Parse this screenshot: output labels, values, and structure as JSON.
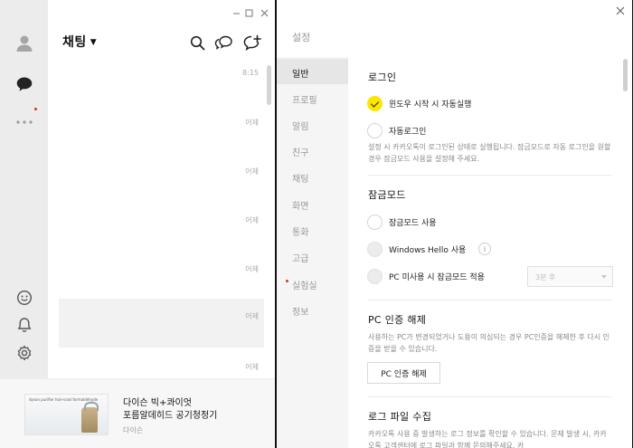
{
  "chat_window": {
    "title": "채팅",
    "rows": [
      {
        "time": "8:15"
      },
      {
        "time": "어제"
      },
      {
        "time": "어제"
      },
      {
        "time": "어제"
      },
      {
        "time": "어제"
      },
      {
        "time": "어제"
      },
      {
        "time": "어제"
      }
    ],
    "ad": {
      "logo": "dyson purifier hot+cool formaldehyde",
      "title": "다이슨 빅+콰이엇\n포름알데히드 공기청정기",
      "brand": "다이슨"
    }
  },
  "settings": {
    "title": "설정",
    "nav": [
      {
        "label": "일반",
        "active": true
      },
      {
        "label": "프로필"
      },
      {
        "label": "알림"
      },
      {
        "label": "친구"
      },
      {
        "label": "채팅"
      },
      {
        "label": "화면"
      },
      {
        "label": "통화"
      },
      {
        "label": "고급"
      },
      {
        "label": "실험실",
        "badge": true
      },
      {
        "label": "정보"
      }
    ],
    "login": {
      "heading": "로그인",
      "autostart_label": "윈도우 시작 시 자동실행",
      "autologin_label": "자동로그인",
      "description": "설정 시 카카오톡이 로그인된 상태로 실행됩니다. 잠금모드로 자동 로그인을 원할 경우 잠금모드 사용을 설정해 주세요."
    },
    "lock": {
      "heading": "잠금모드",
      "use_label": "잠금모드 사용",
      "hello_label": "Windows Hello 사용",
      "idle_label": "PC 미사용 시 잠금모드 적용",
      "idle_select": "3분 후"
    },
    "pc_auth": {
      "heading": "PC 인증 해제",
      "description": "사용하는 PC가 변경되었거나 도용이 의심되는 경우 PC인증을 해제한 후 다시 인증을 받을 수 있습니다.",
      "button": "PC 인증 해제"
    },
    "log": {
      "heading": "로그 파일 수집",
      "description": "카카오톡 사용 중 발생하는 로그 정보를 확인할 수 있습니다. 문제 발생 시, 카카오톡 고객센터에 로그 파일과 함께 문의해주세요. 카"
    }
  }
}
